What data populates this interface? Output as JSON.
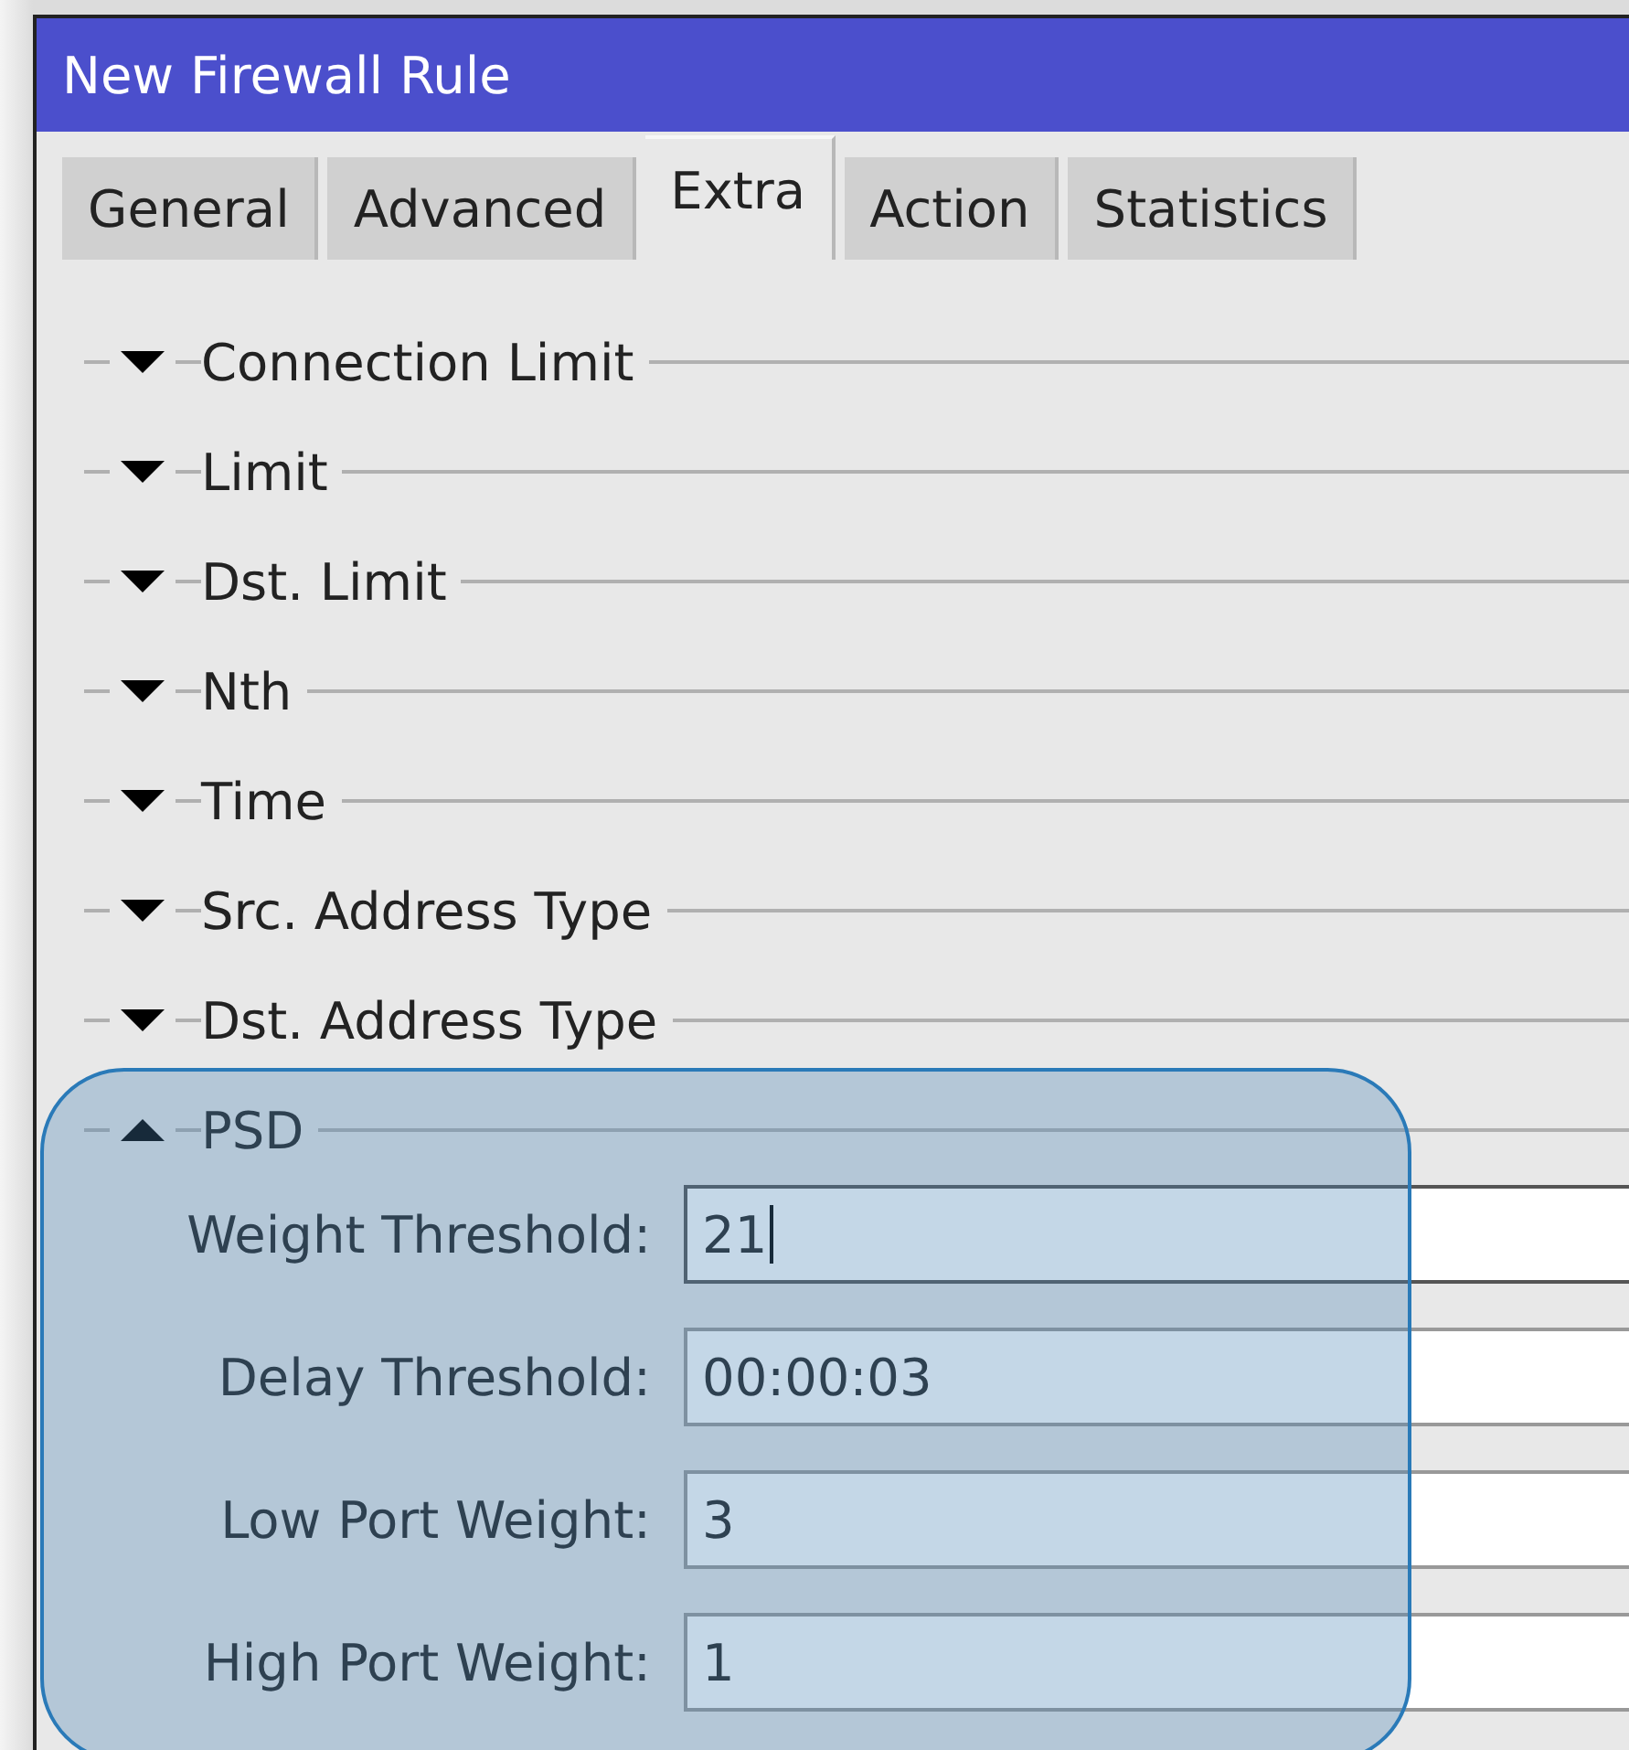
{
  "window": {
    "title": "New Firewall Rule"
  },
  "tabs": [
    {
      "label": "General",
      "selected": false
    },
    {
      "label": "Advanced",
      "selected": false
    },
    {
      "label": "Extra",
      "selected": true
    },
    {
      "label": "Action",
      "selected": false
    },
    {
      "label": "Statistics",
      "selected": false
    }
  ],
  "sections": [
    {
      "title": "Connection Limit",
      "expanded": false,
      "highlighted": false
    },
    {
      "title": "Limit",
      "expanded": false,
      "highlighted": false
    },
    {
      "title": "Dst. Limit",
      "expanded": false,
      "highlighted": false
    },
    {
      "title": "Nth",
      "expanded": false,
      "highlighted": false
    },
    {
      "title": "Time",
      "expanded": false,
      "highlighted": false
    },
    {
      "title": "Src. Address Type",
      "expanded": false,
      "highlighted": false
    },
    {
      "title": "Dst. Address Type",
      "expanded": false,
      "highlighted": false
    },
    {
      "title": "PSD",
      "expanded": true,
      "highlighted": true,
      "fields": [
        {
          "label": "Weight Threshold:",
          "value": "21",
          "focused": true
        },
        {
          "label": "Delay Threshold:",
          "value": "00:00:03",
          "focused": false
        },
        {
          "label": "Low Port Weight:",
          "value": "3",
          "focused": false
        },
        {
          "label": "High Port Weight:",
          "value": "1",
          "focused": false
        }
      ]
    }
  ]
}
